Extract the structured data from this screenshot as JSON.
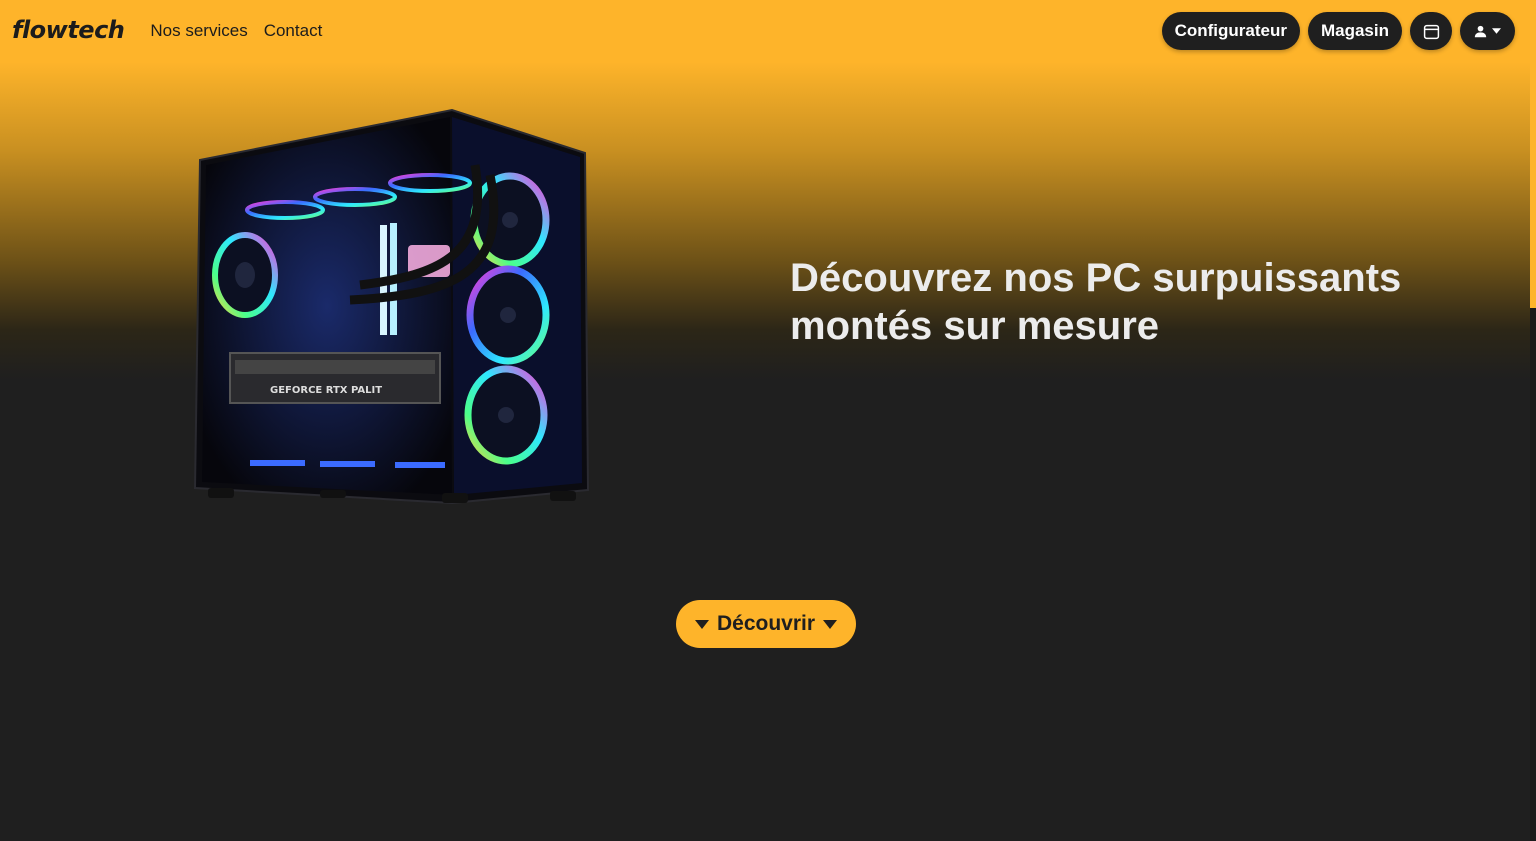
{
  "brand": {
    "logo_text": "flowtech"
  },
  "nav": {
    "links": [
      {
        "label": "Nos services"
      },
      {
        "label": "Contact"
      }
    ],
    "configurateur_label": "Configurateur",
    "magasin_label": "Magasin",
    "calendar_icon": "calendar-icon",
    "user_icon": "user-icon",
    "user_caret_icon": "caret-down-icon"
  },
  "hero": {
    "title": "Découvrez nos PC surpuissants montés sur mesure",
    "image": "gaming-pc-rgb-case"
  },
  "cta": {
    "label": "Découvrir",
    "icon_left": "caret-down-icon",
    "icon_right": "caret-down-icon"
  },
  "colors": {
    "accent": "#FEB42A",
    "dark": "#1F1F1F",
    "text_light": "#ECECEC"
  }
}
